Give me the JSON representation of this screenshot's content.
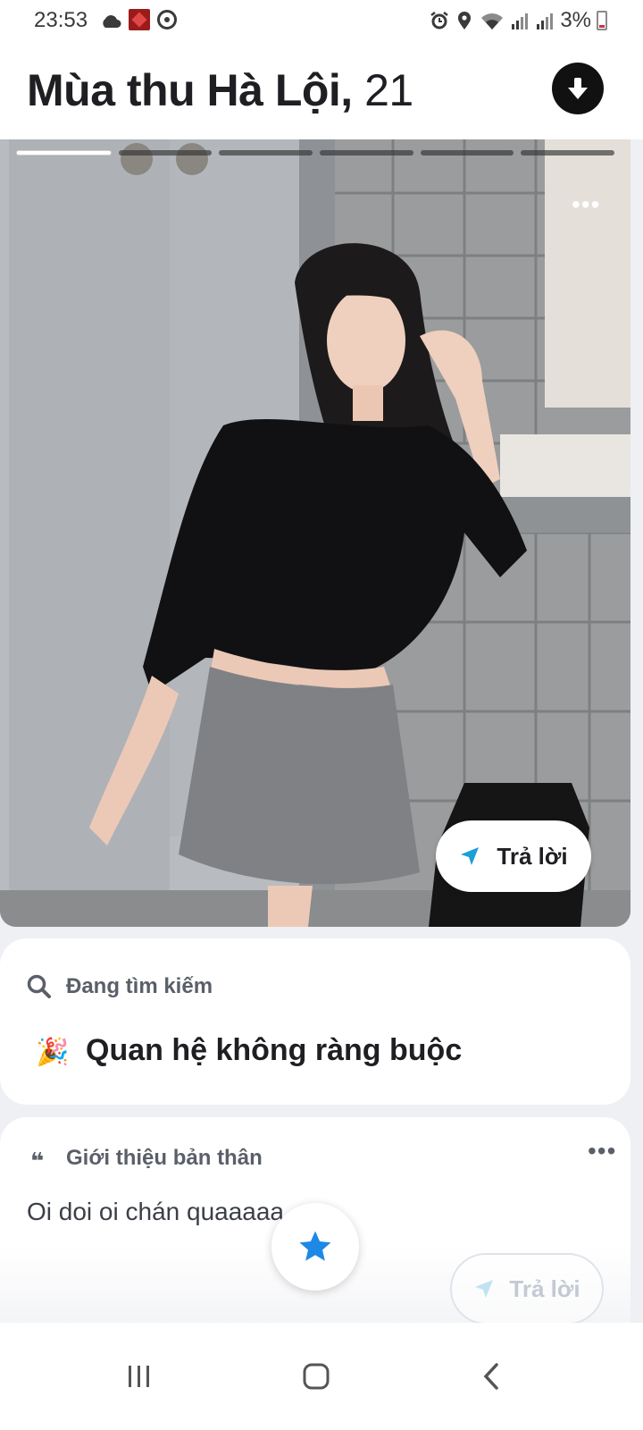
{
  "status_bar": {
    "time": "23:53",
    "battery": "3%",
    "left_icons": [
      "cloud-icon",
      "app-notification-icon",
      "sync-icon"
    ],
    "right_icons": [
      "alarm-icon",
      "location-icon",
      "wifi-icon",
      "signal-icon",
      "signal-icon",
      "battery-icon"
    ]
  },
  "header": {
    "name": "Mùa thu Hà Lội,",
    "age": "21",
    "collapse_icon": "arrow-down-icon"
  },
  "photo": {
    "photo_count": 6,
    "active_photo": 1,
    "more_label": "•••",
    "reply_label": "Trả lời"
  },
  "looking_for": {
    "label": "Đang tìm kiếm",
    "value": "Quan hệ không ràng buộc",
    "emoji": "🎉"
  },
  "bio": {
    "label": "Giới thiệu bản thân",
    "text": "Oi doi oi chán quaaaaa",
    "quote_mark": "❝",
    "more_label": "•••",
    "reply_label": "Trả lời"
  },
  "colors": {
    "accent_blue": "#1a9fd8",
    "superlike_blue": "#1e88e5",
    "text_dark": "#1f1f23",
    "text_muted": "#5a5f69"
  }
}
